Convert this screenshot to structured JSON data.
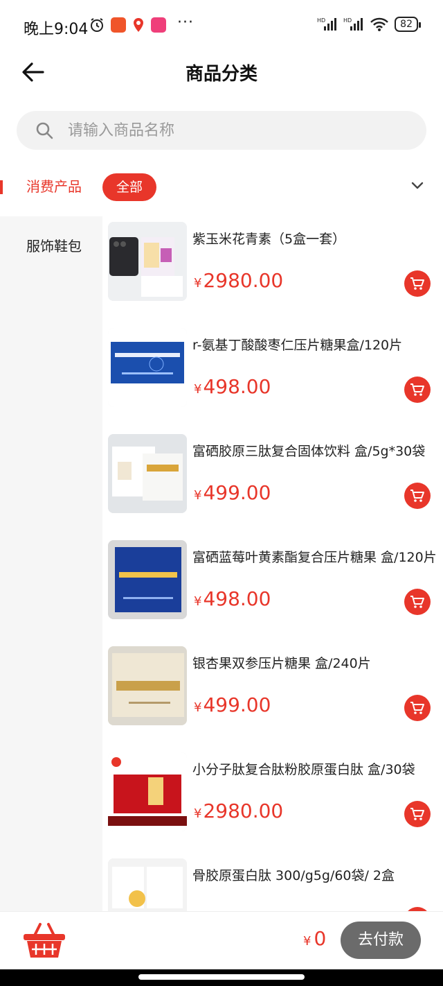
{
  "status": {
    "time": "晚上9:04",
    "dots": "···",
    "signal1": "HD",
    "signal2": "HD",
    "battery": "82"
  },
  "nav": {
    "title": "商品分类"
  },
  "search": {
    "placeholder": "请输入商品名称"
  },
  "sidebar": {
    "items": [
      {
        "label": "消费产品",
        "active": true
      },
      {
        "label": "服饰鞋包",
        "active": false
      }
    ]
  },
  "filter": {
    "chip": "全部"
  },
  "products": [
    {
      "name": "紫玉米花青素（5盒一套）",
      "price": "2980.00"
    },
    {
      "name": "r-氨基丁酸酸枣仁压片糖果盒/120片",
      "price": "498.00"
    },
    {
      "name": "富硒胶原三肽复合固体饮料  盒/5g*30袋",
      "price": "499.00"
    },
    {
      "name": "富硒蓝莓叶黄素酯复合压片糖果   盒/120片",
      "price": "498.00"
    },
    {
      "name": "银杏果双参压片糖果   盒/240片",
      "price": "499.00"
    },
    {
      "name": "小分子肽复合肽粉胶原蛋白肽   盒/30袋",
      "price": "2980.00"
    },
    {
      "name": "骨胶原蛋白肽   300/g5g/60袋/   2盒",
      "price": ""
    }
  ],
  "currency": "¥",
  "cart": {
    "total": "0",
    "pay_label": "去付款"
  },
  "colors": {
    "accent": "#e8362a",
    "pay_button": "#6b6b6b"
  }
}
